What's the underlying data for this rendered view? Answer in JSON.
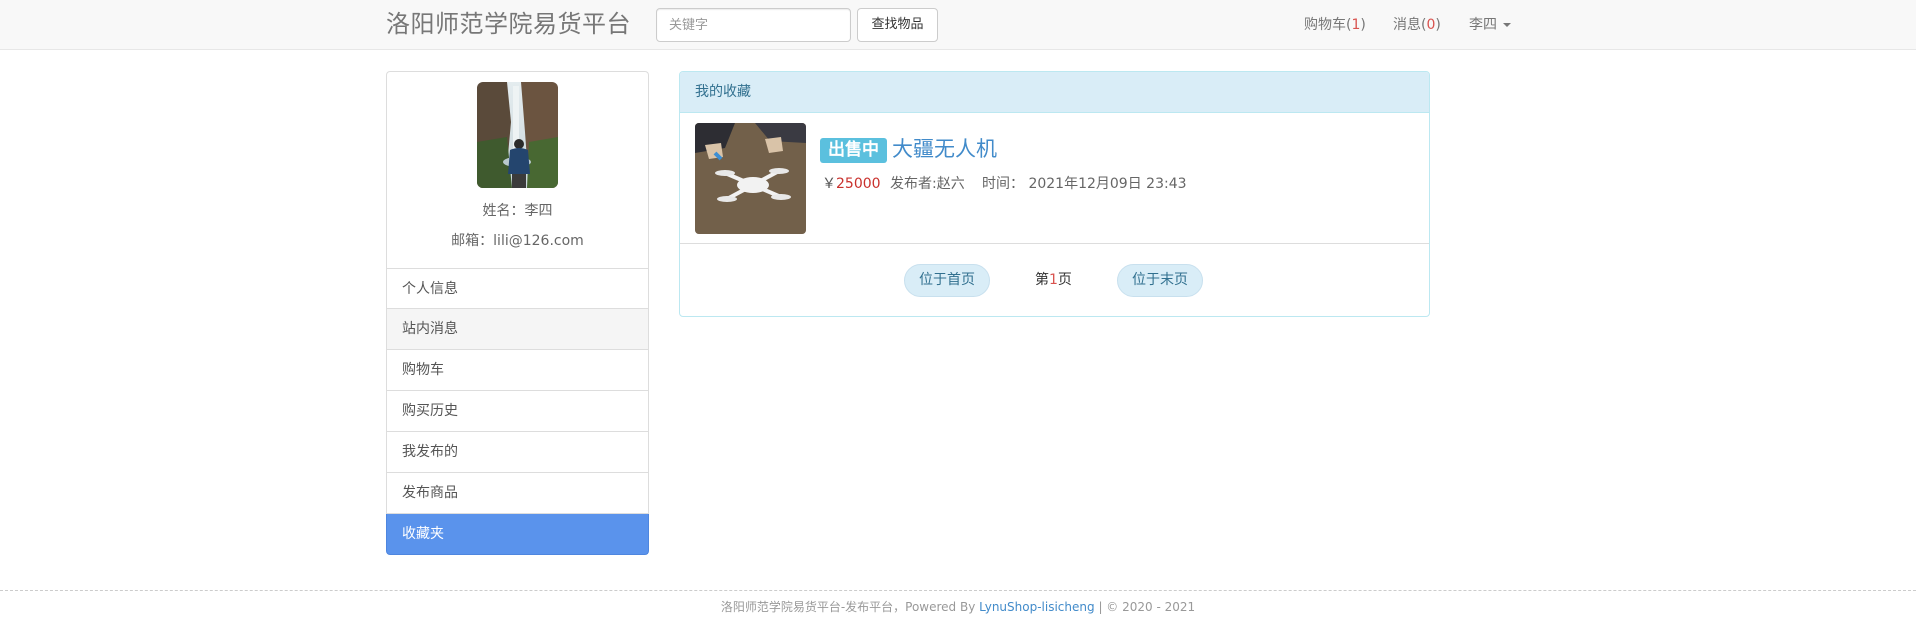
{
  "navbar": {
    "brand": "洛阳师范学院易货平台",
    "search_placeholder": "关键字",
    "search_button": "查找物品",
    "cart_label": "购物车(",
    "cart_count": "1",
    "cart_close": ")",
    "messages_label": "消息(",
    "messages_count": "0",
    "messages_close": ")",
    "user_name": "李四"
  },
  "profile": {
    "name_line": "姓名：李四",
    "email_line": "邮箱：lili@126.com"
  },
  "menu": {
    "items": [
      {
        "label": "个人信息"
      },
      {
        "label": "站内消息"
      },
      {
        "label": "购物车"
      },
      {
        "label": "购买历史"
      },
      {
        "label": "我发布的"
      },
      {
        "label": "发布商品"
      },
      {
        "label": "收藏夹"
      }
    ],
    "active": "收藏夹"
  },
  "favorites": {
    "heading": "我的收藏",
    "items": [
      {
        "status": "出售中",
        "title": "大疆无人机",
        "currency": "￥",
        "price": "25000",
        "seller": "发布者:赵六",
        "time": "时间： 2021年12月09日 23:43"
      }
    ],
    "pager": {
      "first": "位于首页",
      "current_prefix": "第",
      "current_page": "1",
      "current_suffix": "页",
      "last": "位于末页"
    }
  },
  "footer": {
    "text": "洛阳师范学院易货平台-发布平台，Powered By ",
    "link": "LynuShop-lisicheng",
    "sep": " | ",
    "copyright": "© 2020 - 2021"
  },
  "colors": {
    "accent": "#5a93ec",
    "info_bg": "#d9edf7",
    "badge": "#5bc0de",
    "count": "#d9534f"
  }
}
